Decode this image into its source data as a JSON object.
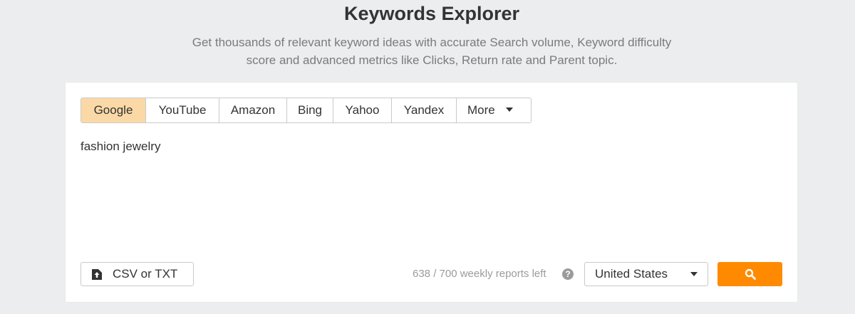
{
  "header": {
    "title": "Keywords Explorer",
    "subtitle_line1": "Get thousands of relevant keyword ideas with accurate Search volume, Keyword difficulty",
    "subtitle_line2": "score and advanced metrics like Clicks, Return rate and Parent topic."
  },
  "engines": {
    "active": "Google",
    "tabs": [
      {
        "label": "Google"
      },
      {
        "label": "YouTube"
      },
      {
        "label": "Amazon"
      },
      {
        "label": "Bing"
      },
      {
        "label": "Yahoo"
      },
      {
        "label": "Yandex"
      },
      {
        "label": "More"
      }
    ]
  },
  "keyword_input": {
    "value": "fashion jewelry"
  },
  "upload": {
    "label": "CSV or TXT",
    "icon": "upload-icon"
  },
  "quota": {
    "text": "638 / 700 weekly reports left",
    "help_glyph": "?"
  },
  "country": {
    "selected": "United States"
  },
  "search": {
    "icon": "search-icon"
  },
  "colors": {
    "background": "#ecedef",
    "active_tab": "#fbd9a7",
    "search_button": "#ff8a00"
  }
}
